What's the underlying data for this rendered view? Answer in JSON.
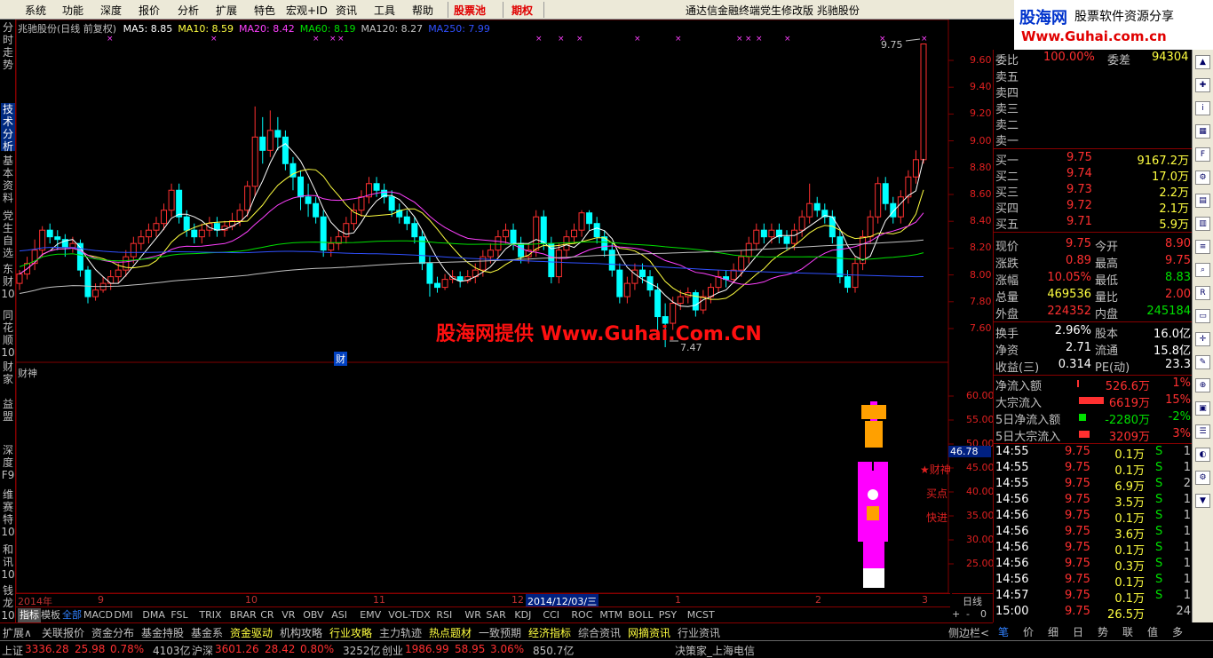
{
  "menu": {
    "items": [
      "系统",
      "功能",
      "深度",
      "报价",
      "分析",
      "扩展",
      "特色",
      "宏观+ID",
      "资讯",
      "工具",
      "帮助"
    ],
    "highlight1": "股票池",
    "highlight2": "期权",
    "window_title": "通达信金融终端党生修改版  兆驰股份",
    "logo_line1": "股海网",
    "logo_line2": "股票软件资源分享",
    "logo_line3": "Www.Guhai.com.cn"
  },
  "left_tabs": [
    "分时走势",
    "技术分析",
    "基本资料",
    "党生自选",
    "东财10",
    "同花顺10",
    "财家",
    "益盟",
    "深度F9",
    "维赛特10",
    "和讯10",
    "钱龙10"
  ],
  "chart": {
    "title": "兆驰股份(日线 前复权)",
    "ma": [
      {
        "label": "MA5: 8.85",
        "color": "#ffffff"
      },
      {
        "label": "MA10: 8.59",
        "color": "#ffff40"
      },
      {
        "label": "MA20: 8.42",
        "color": "#ff40ff"
      },
      {
        "label": "MA60: 8.19",
        "color": "#00e000"
      },
      {
        "label": "MA120: 8.27",
        "color": "#c0c0c0"
      },
      {
        "label": "MA250: 7.99",
        "color": "#3050ff"
      }
    ],
    "high_label": "9.75",
    "low_label": "7.47",
    "cai_marker": "财",
    "sub_title": "财神",
    "sub_value": "46.78",
    "signals": [
      "★财神",
      "买点",
      "快进"
    ],
    "y_labels": [
      "9.60",
      "9.40",
      "9.20",
      "9.00",
      "8.80",
      "8.60",
      "8.40",
      "8.20",
      "8.00",
      "7.80",
      "7.60"
    ],
    "sub_y_labels": [
      "60.00",
      "55.00",
      "50.00",
      "45.00",
      "40.00",
      "35.00",
      "30.00",
      "25.00"
    ],
    "x_labels": [
      "2014年",
      "9",
      "10",
      "11",
      "12",
      "2014/12/03/三",
      "1",
      "2",
      "3"
    ],
    "period": "日线"
  },
  "chart_data": {
    "type": "candlestick",
    "ylim": [
      7.45,
      9.8
    ],
    "candles": [
      [
        7.95,
        8.02,
        7.9,
        8.05
      ],
      [
        8.02,
        8.1,
        7.98,
        8.15
      ],
      [
        8.1,
        8.2,
        8.05,
        8.28
      ],
      [
        8.2,
        8.35,
        8.15,
        8.38
      ],
      [
        8.35,
        8.3,
        8.25,
        8.4
      ],
      [
        8.3,
        8.28,
        8.2,
        8.35
      ],
      [
        8.28,
        8.22,
        8.15,
        8.32
      ],
      [
        8.22,
        8.25,
        8.18,
        8.3
      ],
      [
        8.25,
        8.05,
        8.0,
        8.28
      ],
      [
        8.05,
        7.85,
        7.8,
        8.08
      ],
      [
        7.85,
        7.9,
        7.82,
        7.95
      ],
      [
        7.9,
        7.95,
        7.88,
        8.0
      ],
      [
        7.95,
        8.0,
        7.9,
        8.05
      ],
      [
        8.0,
        8.05,
        7.95,
        8.1
      ],
      [
        8.05,
        8.15,
        8.0,
        8.2
      ],
      [
        8.15,
        8.25,
        8.1,
        8.3
      ],
      [
        8.25,
        8.3,
        8.2,
        8.35
      ],
      [
        8.3,
        8.35,
        8.25,
        8.4
      ],
      [
        8.35,
        8.4,
        8.3,
        8.45
      ],
      [
        8.4,
        8.5,
        8.35,
        8.55
      ],
      [
        8.5,
        8.65,
        8.45,
        8.7
      ],
      [
        8.65,
        8.45,
        8.4,
        8.7
      ],
      [
        8.45,
        8.35,
        8.3,
        8.5
      ],
      [
        8.35,
        8.3,
        8.25,
        8.4
      ],
      [
        8.3,
        8.35,
        8.25,
        8.4
      ],
      [
        8.35,
        8.4,
        8.3,
        8.45
      ],
      [
        8.4,
        8.35,
        8.3,
        8.45
      ],
      [
        8.35,
        8.38,
        8.3,
        8.42
      ],
      [
        8.38,
        8.42,
        8.35,
        8.48
      ],
      [
        8.42,
        8.5,
        8.38,
        8.55
      ],
      [
        8.5,
        8.68,
        8.45,
        8.72
      ],
      [
        8.68,
        9.05,
        8.6,
        9.28
      ],
      [
        9.05,
        8.95,
        8.85,
        9.2
      ],
      [
        8.95,
        9.1,
        8.9,
        9.25
      ],
      [
        9.1,
        9.05,
        8.95,
        9.2
      ],
      [
        9.05,
        8.85,
        8.8,
        9.1
      ],
      [
        8.85,
        8.75,
        8.65,
        8.9
      ],
      [
        8.75,
        8.6,
        8.5,
        8.8
      ],
      [
        8.6,
        8.55,
        8.45,
        8.7
      ],
      [
        8.55,
        8.45,
        8.4,
        8.6
      ],
      [
        8.45,
        8.2,
        8.15,
        8.5
      ],
      [
        8.2,
        8.25,
        8.15,
        8.3
      ],
      [
        8.25,
        8.3,
        8.2,
        8.35
      ],
      [
        8.3,
        8.4,
        8.25,
        8.45
      ],
      [
        8.4,
        8.5,
        8.35,
        8.55
      ],
      [
        8.5,
        8.6,
        8.45,
        8.65
      ],
      [
        8.6,
        8.7,
        8.55,
        8.75
      ],
      [
        8.7,
        8.65,
        8.6,
        8.75
      ],
      [
        8.65,
        8.6,
        8.55,
        8.7
      ],
      [
        8.6,
        8.5,
        8.45,
        8.65
      ],
      [
        8.5,
        8.45,
        8.4,
        8.55
      ],
      [
        8.45,
        8.4,
        8.35,
        8.5
      ],
      [
        8.4,
        8.3,
        8.25,
        8.45
      ],
      [
        8.3,
        8.1,
        8.05,
        8.35
      ],
      [
        8.1,
        7.95,
        7.85,
        8.15
      ],
      [
        7.95,
        7.92,
        7.88,
        8.0
      ],
      [
        7.92,
        7.98,
        7.9,
        8.02
      ],
      [
        7.98,
        8.0,
        7.95,
        8.05
      ],
      [
        8.0,
        7.97,
        7.92,
        8.04
      ],
      [
        7.97,
        8.0,
        7.95,
        8.05
      ],
      [
        8.0,
        8.05,
        7.95,
        8.1
      ],
      [
        8.05,
        8.15,
        8.0,
        8.2
      ],
      [
        8.15,
        8.2,
        8.1,
        8.25
      ],
      [
        8.2,
        8.3,
        8.15,
        8.35
      ],
      [
        8.3,
        8.35,
        8.25,
        8.4
      ],
      [
        8.35,
        8.25,
        8.2,
        8.4
      ],
      [
        8.25,
        8.15,
        8.1,
        8.3
      ],
      [
        8.15,
        8.2,
        8.1,
        8.25
      ],
      [
        8.2,
        8.45,
        8.15,
        8.5
      ],
      [
        8.45,
        8.25,
        8.2,
        8.5
      ],
      [
        8.25,
        8.0,
        7.95,
        8.3
      ],
      [
        8.0,
        8.2,
        7.95,
        8.25
      ],
      [
        8.2,
        8.3,
        8.15,
        8.35
      ],
      [
        8.3,
        8.35,
        8.25,
        8.4
      ],
      [
        8.35,
        8.48,
        8.3,
        8.5
      ],
      [
        8.48,
        8.4,
        8.35,
        8.5
      ],
      [
        8.4,
        8.3,
        8.25,
        8.45
      ],
      [
        8.3,
        8.2,
        8.15,
        8.35
      ],
      [
        8.2,
        8.05,
        8.0,
        8.25
      ],
      [
        8.05,
        7.85,
        7.8,
        8.1
      ],
      [
        7.85,
        7.95,
        7.8,
        8.0
      ],
      [
        7.95,
        8.05,
        7.9,
        8.1
      ],
      [
        8.05,
        8.0,
        7.95,
        8.1
      ],
      [
        8.0,
        7.9,
        7.85,
        8.05
      ],
      [
        7.9,
        7.7,
        7.6,
        7.95
      ],
      [
        7.7,
        7.65,
        7.47,
        7.8
      ],
      [
        7.65,
        7.8,
        7.6,
        7.85
      ],
      [
        7.8,
        7.85,
        7.75,
        7.9
      ],
      [
        7.85,
        7.88,
        7.8,
        7.92
      ],
      [
        7.88,
        7.75,
        7.7,
        7.9
      ],
      [
        7.75,
        7.85,
        7.72,
        7.9
      ],
      [
        7.85,
        7.92,
        7.8,
        7.95
      ],
      [
        7.92,
        8.0,
        7.88,
        8.05
      ],
      [
        8.0,
        7.98,
        7.92,
        8.05
      ],
      [
        7.98,
        8.05,
        7.95,
        8.1
      ],
      [
        8.05,
        8.15,
        8.0,
        8.2
      ],
      [
        8.15,
        8.25,
        8.1,
        8.3
      ],
      [
        8.25,
        8.35,
        8.2,
        8.4
      ],
      [
        8.35,
        8.3,
        8.25,
        8.4
      ],
      [
        8.3,
        8.35,
        8.25,
        8.4
      ],
      [
        8.35,
        8.3,
        8.25,
        8.4
      ],
      [
        8.3,
        8.25,
        8.2,
        8.35
      ],
      [
        8.25,
        8.35,
        8.2,
        8.4
      ],
      [
        8.35,
        8.45,
        8.3,
        8.5
      ],
      [
        8.45,
        8.55,
        8.4,
        8.7
      ],
      [
        8.55,
        8.5,
        8.45,
        8.6
      ],
      [
        8.5,
        8.45,
        8.4,
        8.55
      ],
      [
        8.45,
        8.3,
        8.25,
        8.5
      ],
      [
        8.3,
        8.0,
        7.95,
        8.35
      ],
      [
        8.0,
        7.92,
        7.88,
        8.05
      ],
      [
        7.92,
        8.1,
        7.88,
        8.15
      ],
      [
        8.1,
        8.3,
        8.05,
        8.35
      ],
      [
        8.3,
        8.45,
        8.25,
        8.5
      ],
      [
        8.45,
        8.7,
        8.4,
        8.75
      ],
      [
        8.7,
        8.55,
        8.5,
        8.75
      ],
      [
        8.55,
        8.45,
        8.4,
        8.6
      ],
      [
        8.45,
        8.6,
        8.4,
        8.65
      ],
      [
        8.6,
        8.75,
        8.55,
        8.8
      ],
      [
        8.75,
        8.88,
        8.7,
        8.95
      ],
      [
        8.88,
        9.75,
        8.85,
        9.75
      ]
    ]
  },
  "quote": {
    "weibi_label": "委比",
    "weibi": "100.00%",
    "weicha_label": "委差",
    "weicha": "94304",
    "sells": [
      {
        "label": "卖五"
      },
      {
        "label": "卖四"
      },
      {
        "label": "卖三"
      },
      {
        "label": "卖二"
      },
      {
        "label": "卖一"
      }
    ],
    "buys": [
      {
        "label": "买一",
        "price": "9.75",
        "vol": "9167.2万"
      },
      {
        "label": "买二",
        "price": "9.74",
        "vol": "17.0万"
      },
      {
        "label": "买三",
        "price": "9.73",
        "vol": "2.2万"
      },
      {
        "label": "买四",
        "price": "9.72",
        "vol": "2.1万"
      },
      {
        "label": "买五",
        "price": "9.71",
        "vol": "5.9万"
      }
    ],
    "stats": [
      {
        "l1": "现价",
        "v1": "9.75",
        "l2": "今开",
        "v2": "8.90",
        "c1": "r",
        "c2": "r"
      },
      {
        "l1": "涨跌",
        "v1": "0.89",
        "l2": "最高",
        "v2": "9.75",
        "c1": "r",
        "c2": "r"
      },
      {
        "l1": "涨幅",
        "v1": "10.05%",
        "l2": "最低",
        "v2": "8.83",
        "c1": "r",
        "c2": "g"
      },
      {
        "l1": "总量",
        "v1": "469536",
        "l2": "量比",
        "v2": "2.00",
        "c1": "y",
        "c2": "r"
      },
      {
        "l1": "外盘",
        "v1": "224352",
        "l2": "内盘",
        "v2": "245184",
        "c1": "r",
        "c2": "g"
      }
    ],
    "stats2": [
      {
        "l1": "换手",
        "v1": "2.96%",
        "l2": "股本",
        "v2": "16.0亿"
      },
      {
        "l1": "净资",
        "v1": "2.71",
        "l2": "流通",
        "v2": "15.8亿"
      },
      {
        "l1": "收益(三)",
        "v1": "0.314",
        "l2": "PE(动)",
        "v2": "23.3"
      }
    ],
    "flows": [
      {
        "label": "净流入额",
        "val": "526.6万",
        "pct": "1%",
        "color": "r"
      },
      {
        "label": "大宗流入",
        "val": "6619万",
        "pct": "15%",
        "color": "r"
      },
      {
        "label": "5日净流入额",
        "val": "-2280万",
        "pct": "-2%",
        "color": "g"
      },
      {
        "label": "5日大宗流入",
        "val": "3209万",
        "pct": "3%",
        "color": "r"
      }
    ],
    "ticks": [
      {
        "t": "14:55",
        "p": "9.75",
        "v": "0.1万",
        "s": "S",
        "n": "1"
      },
      {
        "t": "14:55",
        "p": "9.75",
        "v": "0.1万",
        "s": "S",
        "n": "1"
      },
      {
        "t": "14:55",
        "p": "9.75",
        "v": "6.9万",
        "s": "S",
        "n": "2"
      },
      {
        "t": "14:56",
        "p": "9.75",
        "v": "3.5万",
        "s": "S",
        "n": "1"
      },
      {
        "t": "14:56",
        "p": "9.75",
        "v": "0.1万",
        "s": "S",
        "n": "1"
      },
      {
        "t": "14:56",
        "p": "9.75",
        "v": "3.6万",
        "s": "S",
        "n": "1"
      },
      {
        "t": "14:56",
        "p": "9.75",
        "v": "0.1万",
        "s": "S",
        "n": "1"
      },
      {
        "t": "14:56",
        "p": "9.75",
        "v": "0.3万",
        "s": "S",
        "n": "1"
      },
      {
        "t": "14:56",
        "p": "9.75",
        "v": "0.1万",
        "s": "S",
        "n": "1"
      },
      {
        "t": "14:57",
        "p": "9.75",
        "v": "0.1万",
        "s": "S",
        "n": "1"
      },
      {
        "t": "15:00",
        "p": "9.75",
        "v": "26.5万",
        "s": "",
        "n": "24"
      }
    ]
  },
  "indicator_tabs": [
    "指标",
    "模板",
    "全部",
    "MACD",
    "DMI",
    "DMA",
    "FSL",
    "TRIX",
    "BRAR",
    "CR",
    "VR",
    "OBV",
    "ASI",
    "EMV",
    "VOL-TDX",
    "RSI",
    "WR",
    "SAR",
    "KDJ",
    "CCI",
    "ROC",
    "MTM",
    "BOLL",
    "PSY",
    "MCST"
  ],
  "bottom_tabs": [
    "扩展∧",
    "关联报价",
    "资金分布",
    "基金持股",
    "基金系",
    "资金驱动",
    "机构攻略",
    "行业攻略",
    "主力轨迹",
    "热点题材",
    "一致预期",
    "经济指标",
    "综合资讯",
    "网摘资讯",
    "行业资讯"
  ],
  "side_label": "侧边栏<",
  "right_bottom_tabs": [
    "笔",
    "价",
    "细",
    "日",
    "势",
    "联",
    "值",
    "多"
  ],
  "status": {
    "sh_label": "上证",
    "sh_val": "3336.28",
    "sh_chg": "25.98",
    "sh_pct": "0.78%",
    "sh_amt": "4103亿",
    "hs_label": "沪深",
    "hs_val": "3601.26",
    "hs_chg": "28.42",
    "hs_pct": "0.80%",
    "hs_amt": "3252亿",
    "cy_label": "创业",
    "cy_val": "1986.99",
    "cy_chg": "58.95",
    "cy_pct": "3.06%",
    "cy_amt": "850.7亿",
    "msg": "决策家_上海电信"
  },
  "watermark": "股海网提供 Www.Guhai.Com.CN"
}
